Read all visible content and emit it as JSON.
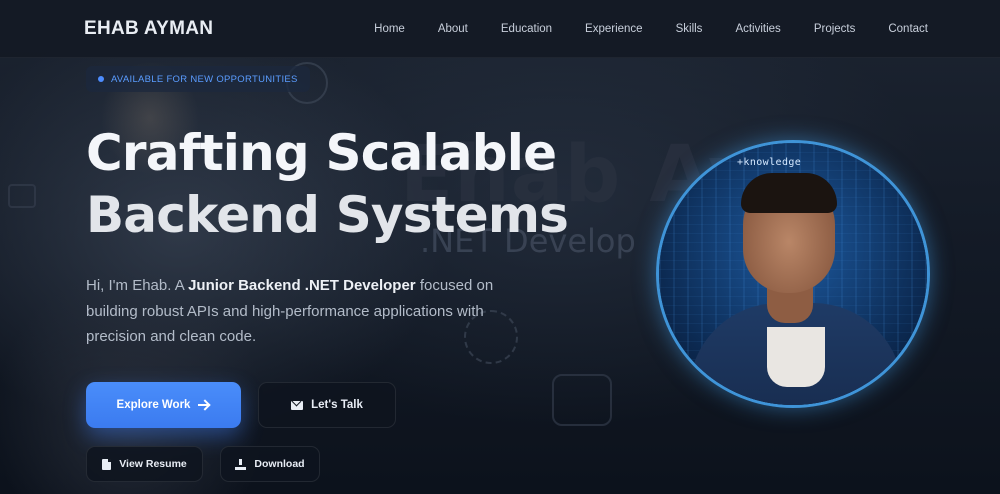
{
  "brand": {
    "name": "EHAB AYMAN"
  },
  "nav": {
    "items": [
      "Home",
      "About",
      "Education",
      "Experience",
      "Skills",
      "Activities",
      "Projects",
      "Contact"
    ]
  },
  "hero": {
    "badge": "AVAILABLE FOR NEW OPPORTUNITIES",
    "headline_line1": "Crafting Scalable",
    "headline_line2": "Backend Systems",
    "intro_prefix": "Hi, I'm Ehab. A ",
    "intro_role": "Junior Backend .NET Developer",
    "intro_suffix": " focused on building robust APIs and high-performance applications with precision and clean code.",
    "buttons": {
      "explore": "Explore Work",
      "talk": "Let's Talk",
      "resume": "View Resume",
      "download": "Download"
    }
  },
  "background": {
    "watermark_name": "Ehab Ay",
    "watermark_title": ".NET Develop"
  },
  "avatar": {
    "code_text": "+knowledge"
  },
  "colors": {
    "accent": "#3b7bf0",
    "badge_text": "#5a9cff",
    "ring": "#3f94d8",
    "background": "#0b111c"
  },
  "icons": {
    "explore": "arrow-right-icon",
    "talk": "mail-icon",
    "resume": "file-icon",
    "download": "download-icon",
    "badge": "status-dot-icon"
  }
}
